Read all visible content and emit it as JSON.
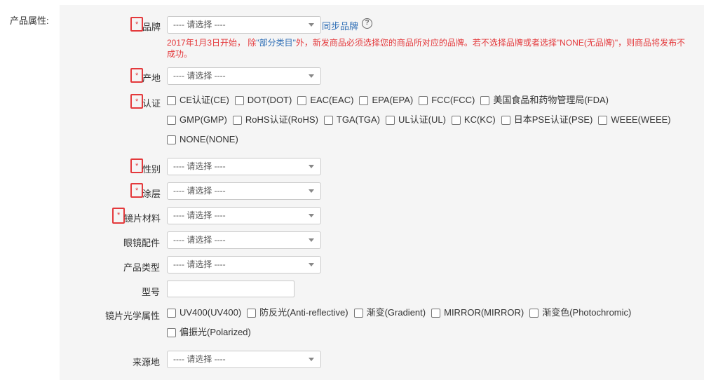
{
  "section_label": "产品属性:",
  "select_placeholder": "---- 请选择 ----",
  "required_mark": "*",
  "brand": {
    "label": "品牌",
    "sync_link": "同步品牌",
    "help_icon": "?",
    "notice_part1": "2017年1月3日开始， 除",
    "notice_link": "\"部分类目\"",
    "notice_part2": "外，新发商品必须选择您的商品所对应的品牌。若不选择品牌或者选择\"NONE(无品牌)\"，则商品将发布不成功。"
  },
  "origin": {
    "label": "产地"
  },
  "certification": {
    "label": "认证",
    "options_line1": [
      "CE认证(CE)",
      "DOT(DOT)",
      "EAC(EAC)",
      "EPA(EPA)",
      "FCC(FCC)",
      "美国食品和药物管理局(FDA)"
    ],
    "options_line2": [
      "GMP(GMP)",
      "RoHS认证(RoHS)",
      "TGA(TGA)",
      "UL认证(UL)",
      "KC(KC)",
      "日本PSE认证(PSE)",
      "WEEE(WEEE)"
    ],
    "options_line3": [
      "NONE(NONE)"
    ]
  },
  "gender": {
    "label": "性别"
  },
  "coating": {
    "label": "涂层"
  },
  "lens_material": {
    "label": "镜片材料"
  },
  "accessories": {
    "label": "眼镜配件"
  },
  "product_type": {
    "label": "产品类型"
  },
  "model": {
    "label": "型号",
    "value": ""
  },
  "optical_attr": {
    "label": "镜片光学属性",
    "options_line1": [
      "UV400(UV400)",
      "防反光(Anti-reflective)",
      "渐变(Gradient)",
      "MIRROR(MIRROR)",
      "渐变色(Photochromic)"
    ],
    "options_line2": [
      "偏振光(Polarized)"
    ]
  },
  "source": {
    "label": "来源地"
  },
  "colors": {
    "required": "#e4393c",
    "link": "#2d6db5",
    "panel": "#f5f5f5"
  }
}
